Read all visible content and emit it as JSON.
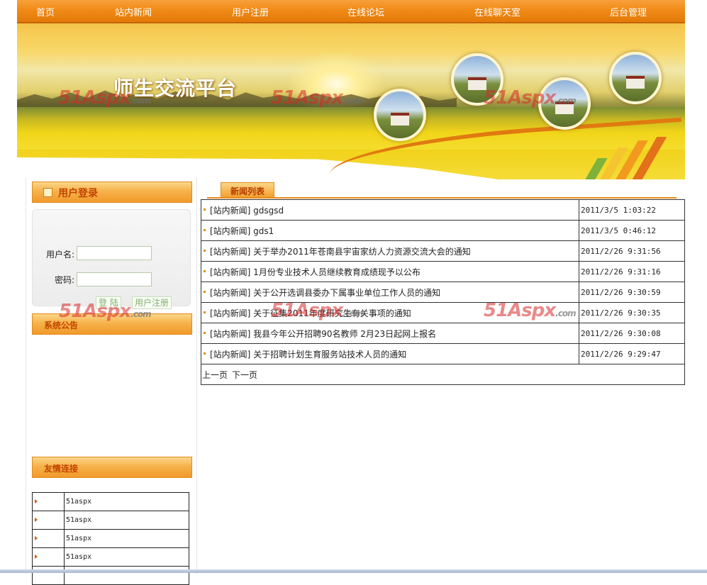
{
  "nav": {
    "items": [
      "首页",
      "站内新闻",
      "用户注册",
      "在线论坛",
      "在线聊天室",
      "后台管理"
    ]
  },
  "banner": {
    "title": "师生交流平台",
    "watermark": "51Aspx",
    "watermark_suffix": ".com"
  },
  "login": {
    "heading": "用户登录",
    "username_label": "用户名:",
    "password_label": "密码:",
    "username_value": "",
    "password_value": "",
    "login_button": "登 陆",
    "register_button": "用户注册"
  },
  "notice": {
    "heading": "系统公告"
  },
  "friends": {
    "heading": "友情连接",
    "links": [
      "51aspx",
      "51aspx",
      "51aspx",
      "51aspx",
      ""
    ]
  },
  "news": {
    "tab": "新闻列表",
    "items": [
      {
        "title": "[站内新闻] gdsgsd",
        "date": "2011/3/5 1:03:22"
      },
      {
        "title": "[站内新闻] gds1",
        "date": "2011/3/5 0:46:12"
      },
      {
        "title": "[站内新闻] 关于举办2011年苍南县宇宙家纺人力资源交流大会的通知",
        "date": "2011/2/26 9:31:56"
      },
      {
        "title": "[站内新闻] 1月份专业技术人员继续教育成绩现予以公布",
        "date": "2011/2/26 9:31:16"
      },
      {
        "title": "[站内新闻] 关于公开选调县委办下属事业单位工作人员的通知",
        "date": "2011/2/26 9:30:59"
      },
      {
        "title": "[站内新闻] 关于征集2011年度研究生有关事项的通知",
        "date": "2011/2/26 9:30:35"
      },
      {
        "title": "[站内新闻] 我县今年公开招聘90名教师 2月23日起网上报名",
        "date": "2011/2/26 9:30:08"
      },
      {
        "title": "[站内新闻] 关于招聘计划生育服务站技术人员的通知",
        "date": "2011/2/26 9:29:47"
      }
    ],
    "prev_page": "上一页",
    "next_page": "下一页"
  },
  "colors": {
    "nav_orange": "#f08a17",
    "panel_orange": "#f6b24b",
    "heading_red": "#c24400"
  }
}
